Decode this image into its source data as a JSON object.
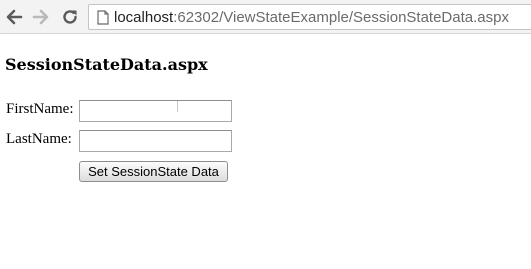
{
  "browser": {
    "url_host": "localhost",
    "url_rest": ":62302/ViewStateExample/SessionStateData.aspx",
    "back_icon": "arrow-left-icon",
    "forward_icon": "arrow-right-icon",
    "reload_icon": "reload-icon",
    "page_icon": "page-icon"
  },
  "page": {
    "title": "SessionStateData.aspx"
  },
  "form": {
    "first_name_label": "FirstName:",
    "first_name_value": "",
    "last_name_label": "LastName:",
    "last_name_value": "",
    "submit_label": "Set SessionState Data"
  }
}
